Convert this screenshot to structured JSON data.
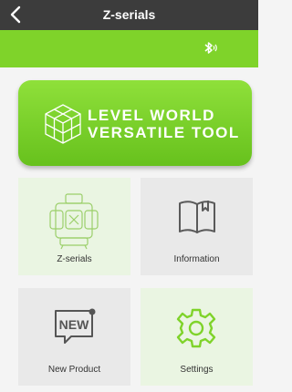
{
  "header": {
    "title": "Z-serials"
  },
  "banner": {
    "line1": "LEVEL WORLD",
    "line2": "VERSATILE TOOL"
  },
  "tiles": [
    {
      "label": "Z-serials"
    },
    {
      "label": "Information"
    },
    {
      "label": "New Product",
      "icon_text": "NEW"
    },
    {
      "label": "Settings"
    }
  ],
  "colors": {
    "accent": "#7fd32a",
    "header_bg": "#3c3c3c",
    "tile_green": "#eaf5e2",
    "tile_gray": "#e9e9e9"
  }
}
